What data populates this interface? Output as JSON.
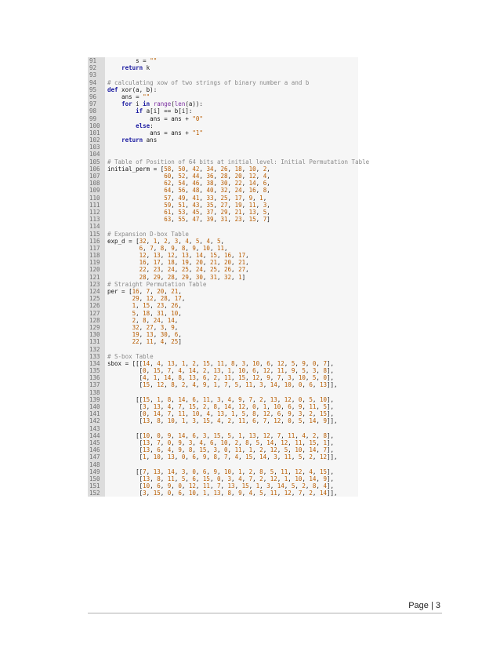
{
  "code": {
    "lines": [
      {
        "n": "91",
        "t": "        s = \"\""
      },
      {
        "n": "92",
        "t": "    return k"
      },
      {
        "n": "93",
        "t": ""
      },
      {
        "n": "94",
        "t": "# calculating xow of two strings of binary number a and b"
      },
      {
        "n": "95",
        "t": "def xor(a, b):"
      },
      {
        "n": "96",
        "t": "    ans = \"\""
      },
      {
        "n": "97",
        "t": "    for i in range(len(a)):"
      },
      {
        "n": "98",
        "t": "        if a[i] == b[i]:"
      },
      {
        "n": "99",
        "t": "            ans = ans + \"0\""
      },
      {
        "n": "100",
        "t": "        else:"
      },
      {
        "n": "101",
        "t": "            ans = ans + \"1\""
      },
      {
        "n": "102",
        "t": "    return ans"
      },
      {
        "n": "103",
        "t": ""
      },
      {
        "n": "104",
        "t": ""
      },
      {
        "n": "105",
        "t": "# Table of Position of 64 bits at initial level: Initial Permutation Table"
      },
      {
        "n": "106",
        "t": "initial_perm = [58, 50, 42, 34, 26, 18, 10, 2,"
      },
      {
        "n": "107",
        "t": "                60, 52, 44, 36, 28, 20, 12, 4,"
      },
      {
        "n": "108",
        "t": "                62, 54, 46, 38, 30, 22, 14, 6,"
      },
      {
        "n": "109",
        "t": "                64, 56, 48, 40, 32, 24, 16, 8,"
      },
      {
        "n": "110",
        "t": "                57, 49, 41, 33, 25, 17, 9, 1,"
      },
      {
        "n": "111",
        "t": "                59, 51, 43, 35, 27, 19, 11, 3,"
      },
      {
        "n": "112",
        "t": "                61, 53, 45, 37, 29, 21, 13, 5,"
      },
      {
        "n": "113",
        "t": "                63, 55, 47, 39, 31, 23, 15, 7]"
      },
      {
        "n": "114",
        "t": ""
      },
      {
        "n": "115",
        "t": "# Expansion D-box Table"
      },
      {
        "n": "116",
        "t": "exp_d = [32, 1, 2, 3, 4, 5, 4, 5,"
      },
      {
        "n": "117",
        "t": "         6, 7, 8, 9, 8, 9, 10, 11,"
      },
      {
        "n": "118",
        "t": "         12, 13, 12, 13, 14, 15, 16, 17,"
      },
      {
        "n": "119",
        "t": "         16, 17, 18, 19, 20, 21, 20, 21,"
      },
      {
        "n": "120",
        "t": "         22, 23, 24, 25, 24, 25, 26, 27,"
      },
      {
        "n": "121",
        "t": "         28, 29, 28, 29, 30, 31, 32, 1]"
      },
      {
        "n": "123",
        "t": "# Straight Permutation Table"
      },
      {
        "n": "124",
        "t": "per = [16, 7, 20, 21,"
      },
      {
        "n": "125",
        "t": "       29, 12, 28, 17,"
      },
      {
        "n": "126",
        "t": "       1, 15, 23, 26,"
      },
      {
        "n": "127",
        "t": "       5, 18, 31, 10,"
      },
      {
        "n": "128",
        "t": "       2, 8, 24, 14,"
      },
      {
        "n": "129",
        "t": "       32, 27, 3, 9,"
      },
      {
        "n": "130",
        "t": "       19, 13, 30, 6,"
      },
      {
        "n": "131",
        "t": "       22, 11, 4, 25]"
      },
      {
        "n": "132",
        "t": ""
      },
      {
        "n": "133",
        "t": "# S-box Table"
      },
      {
        "n": "134",
        "t": "sbox = [[[14, 4, 13, 1, 2, 15, 11, 8, 3, 10, 6, 12, 5, 9, 0, 7],"
      },
      {
        "n": "135",
        "t": "         [0, 15, 7, 4, 14, 2, 13, 1, 10, 6, 12, 11, 9, 5, 3, 8],"
      },
      {
        "n": "136",
        "t": "         [4, 1, 14, 8, 13, 6, 2, 11, 15, 12, 9, 7, 3, 10, 5, 0],"
      },
      {
        "n": "137",
        "t": "         [15, 12, 8, 2, 4, 9, 1, 7, 5, 11, 3, 14, 10, 0, 6, 13]],"
      },
      {
        "n": "138",
        "t": ""
      },
      {
        "n": "139",
        "t": "        [[15, 1, 8, 14, 6, 11, 3, 4, 9, 7, 2, 13, 12, 0, 5, 10],"
      },
      {
        "n": "140",
        "t": "         [3, 13, 4, 7, 15, 2, 8, 14, 12, 0, 1, 10, 6, 9, 11, 5],"
      },
      {
        "n": "141",
        "t": "         [0, 14, 7, 11, 10, 4, 13, 1, 5, 8, 12, 6, 9, 3, 2, 15],"
      },
      {
        "n": "142",
        "t": "         [13, 8, 10, 1, 3, 15, 4, 2, 11, 6, 7, 12, 0, 5, 14, 9]],"
      },
      {
        "n": "143",
        "t": ""
      },
      {
        "n": "144",
        "t": "        [[10, 0, 9, 14, 6, 3, 15, 5, 1, 13, 12, 7, 11, 4, 2, 8],"
      },
      {
        "n": "145",
        "t": "         [13, 7, 0, 9, 3, 4, 6, 10, 2, 8, 5, 14, 12, 11, 15, 1],"
      },
      {
        "n": "146",
        "t": "         [13, 6, 4, 9, 8, 15, 3, 0, 11, 1, 2, 12, 5, 10, 14, 7],"
      },
      {
        "n": "147",
        "t": "         [1, 10, 13, 0, 6, 9, 8, 7, 4, 15, 14, 3, 11, 5, 2, 12]],"
      },
      {
        "n": "148",
        "t": ""
      },
      {
        "n": "149",
        "t": "        [[7, 13, 14, 3, 0, 6, 9, 10, 1, 2, 8, 5, 11, 12, 4, 15],"
      },
      {
        "n": "150",
        "t": "         [13, 8, 11, 5, 6, 15, 0, 3, 4, 7, 2, 12, 1, 10, 14, 9],"
      },
      {
        "n": "151",
        "t": "         [10, 6, 9, 0, 12, 11, 7, 13, 15, 1, 3, 14, 5, 2, 8, 4],"
      },
      {
        "n": "152",
        "t": "         [3, 15, 0, 6, 10, 1, 13, 8, 9, 4, 5, 11, 12, 7, 2, 14]],"
      }
    ]
  },
  "footer": {
    "page_label": "Page | 3"
  }
}
